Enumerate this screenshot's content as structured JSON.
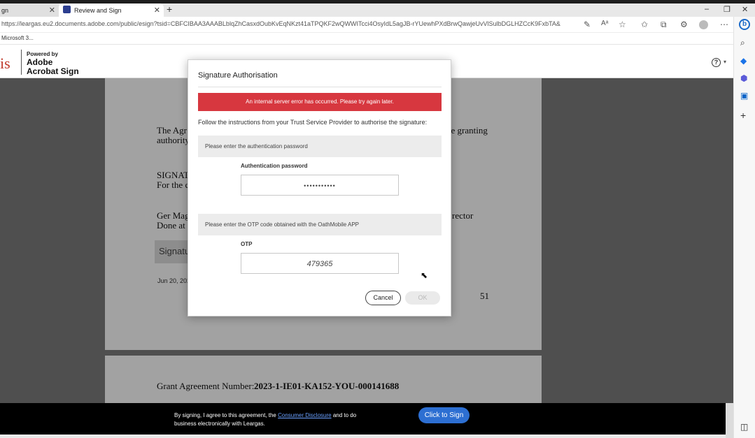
{
  "browser": {
    "tabs": [
      {
        "label": "gn",
        "close": "✕"
      },
      {
        "label": "Review and Sign",
        "close": "✕"
      }
    ],
    "new_tab": "+",
    "window_controls": {
      "minimize": "–",
      "restore": "❐",
      "close": "✕"
    },
    "url": "https://leargas.eu2.documents.adobe.com/public/esign?tsid=CBFCIBAA3AAABLblqZhCasxdOubKvEqNKzt41aTPQKF2wQWWITcci4OsyIdL5agJB-rYUewhPXdBrwQawjeUvVlSulbDGLHZCcK9FxbTA&",
    "favorites_item": "Microsoft 3...",
    "toolbar_icons": [
      "edit-icon",
      "read-aloud-icon",
      "favorite-icon",
      "favorites-icon",
      "collections-icon",
      "extensions-icon",
      "profile-icon",
      "more-icon"
    ],
    "sidebar_icons": [
      "bing-icon",
      "search-icon",
      "shopping-icon",
      "games-icon",
      "outlook-icon",
      "add-icon"
    ]
  },
  "header": {
    "brand_fragment": "is",
    "powered_by": "Powered by",
    "adobe_line1": "Adobe",
    "adobe_line2": "Acrobat Sign",
    "help": "?",
    "help_caret": "▾"
  },
  "document": {
    "lines": [
      {
        "text": "The Agr",
        "tail": "he granting"
      },
      {
        "text": "authority"
      },
      {
        "text": "SIGNAT"
      },
      {
        "text": "For the c"
      },
      {
        "text": "Ger Mag",
        "tail": "rector"
      },
      {
        "text": "Done at"
      }
    ],
    "signature_label": "Signatu",
    "date": "Jun 20, 202",
    "page_number": "51",
    "grant_label": "Grant Agreement Number:",
    "grant_number": "2023-1-IE01-KA152-YOU-000141688"
  },
  "modal": {
    "title": "Signature Authorisation",
    "error": "An internal server error has occurred. Please try again later.",
    "instructions": "Follow the instructions from your Trust Service Provider to authorise the signature:",
    "password_section": "Please enter the authentication password",
    "password_label": "Authentication password",
    "password_value": "•••••••••••",
    "otp_section": "Please enter the OTP code obtained with the OathMobile APP",
    "otp_label": "OTP",
    "otp_value": "479365",
    "cancel": "Cancel",
    "ok": "OK"
  },
  "sign_bar": {
    "text_before": "By signing, I agree to this agreement, the",
    "link": "Consumer Disclosure",
    "text_after": "and to do business electronically with Leargas.",
    "button": "Click to Sign"
  },
  "colors": {
    "error_red": "#d7373f",
    "sign_button_blue": "#2d6fd2",
    "brand_red": "#c0392b"
  }
}
